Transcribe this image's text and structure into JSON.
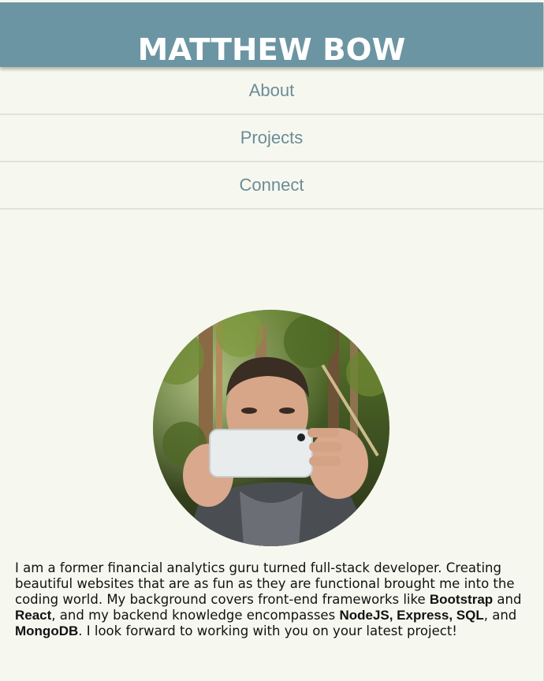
{
  "header": {
    "title": "MATTHEW BOW",
    "background": "#6c95a3"
  },
  "nav": {
    "items": [
      {
        "label": "About"
      },
      {
        "label": "Projects"
      },
      {
        "label": "Connect"
      }
    ]
  },
  "profile": {
    "photo_description_icon": "person-holding-phone-photo"
  },
  "bio": {
    "part1": "I am a former financial analytics guru turned full-stack developer. Creating beautiful websites that are as fun as they are functional brought me into the coding world. My background covers front-end frameworks like ",
    "tech1": "Bootstrap",
    "part2": " and ",
    "tech2": "React",
    "part3": ", and my backend knowledge encompasses ",
    "tech3": "NodeJS, Express, SQL",
    "part4": ", and ",
    "tech4": "MongoDB",
    "part5": ". I look forward to working with you on your latest project!"
  },
  "colors": {
    "page_background": "#f6f8ef",
    "nav_text": "#6c8b98"
  }
}
